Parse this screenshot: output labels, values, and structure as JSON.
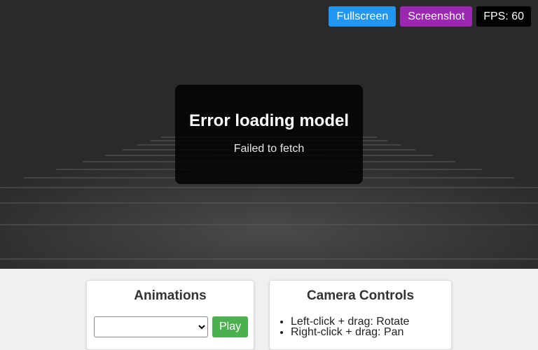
{
  "toolbar": {
    "fullscreen_label": "Fullscreen",
    "screenshot_label": "Screenshot",
    "fps_text": "FPS: 60"
  },
  "error": {
    "title": "Error loading model",
    "message": "Failed to fetch"
  },
  "animations_panel": {
    "title": "Animations",
    "selected_animation": "",
    "play_label": "Play"
  },
  "camera_panel": {
    "title": "Camera Controls",
    "items": [
      "Left-click + drag: Rotate",
      "Right-click + drag: Pan"
    ]
  },
  "colors": {
    "fullscreen": "#2196f3",
    "screenshot": "#9c27b0",
    "play": "#4caf50",
    "viewport_bg": "#2b2b2b"
  }
}
